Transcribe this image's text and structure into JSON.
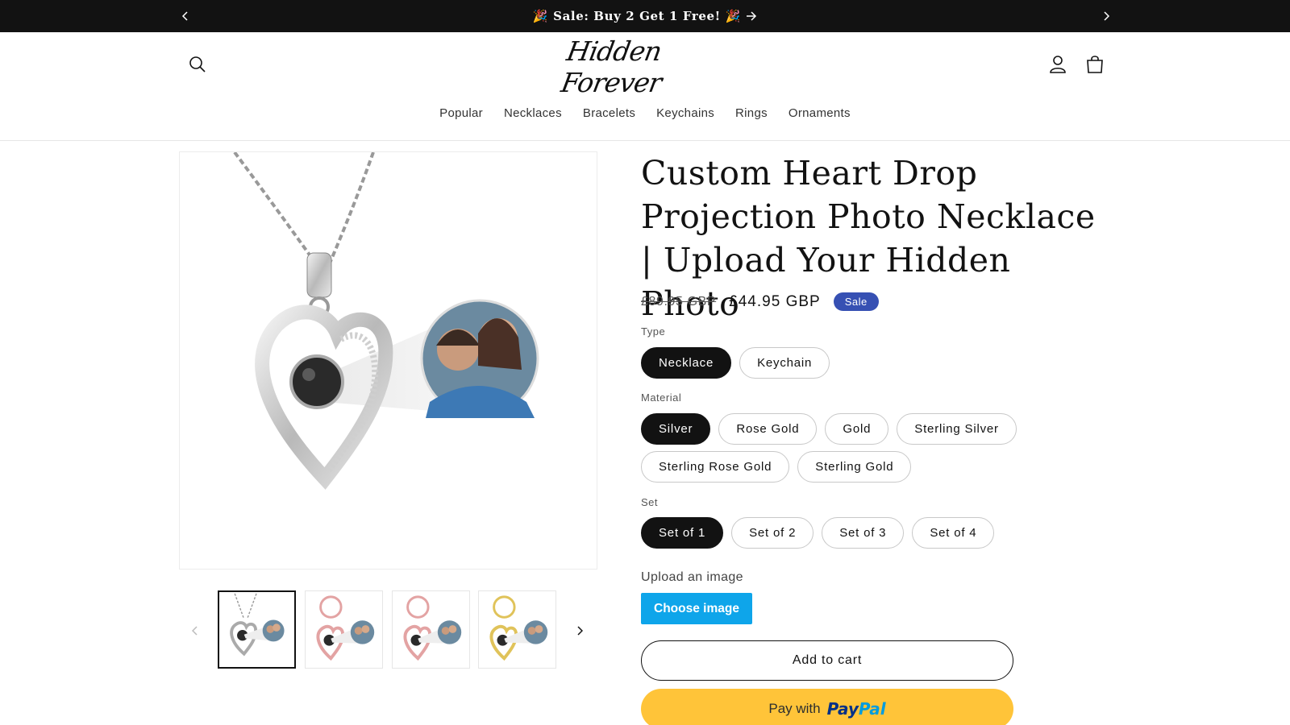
{
  "announcement": {
    "text": "Sale: Buy 2 Get 1 Free!",
    "emoji_left": "🎉",
    "emoji_right": "🎉"
  },
  "header": {
    "logo_text": "Hidden Forever",
    "nav": [
      "Popular",
      "Necklaces",
      "Bracelets",
      "Keychains",
      "Rings",
      "Ornaments"
    ]
  },
  "product": {
    "title": "Custom Heart Drop Projection Photo Necklace | Upload Your Hidden Photo",
    "price_old": "£89.95 GBP",
    "price_new": "£44.95 GBP",
    "badge": "Sale",
    "options": {
      "type": {
        "label": "Type",
        "values": [
          "Necklace",
          "Keychain"
        ],
        "selected": "Necklace"
      },
      "material": {
        "label": "Material",
        "values": [
          "Silver",
          "Rose Gold",
          "Gold",
          "Sterling Silver",
          "Sterling Rose Gold",
          "Sterling Gold"
        ],
        "selected": "Silver"
      },
      "set": {
        "label": "Set",
        "values": [
          "Set of 1",
          "Set of 2",
          "Set of 3",
          "Set of 4"
        ],
        "selected": "Set of 1"
      }
    },
    "upload_label": "Upload an image",
    "choose_label": "Choose image",
    "add_to_cart": "Add to cart",
    "paypal_prefix": "Pay with",
    "paypal_brand_1": "Pay",
    "paypal_brand_2": "Pal"
  },
  "gallery": {
    "thumbnails": [
      {
        "metal": "silver",
        "active": true
      },
      {
        "metal": "rose-gold",
        "active": false
      },
      {
        "metal": "rose-gold",
        "active": false
      },
      {
        "metal": "gold",
        "active": false
      }
    ]
  },
  "colors": {
    "announcement_bg": "#121212",
    "sale_badge": "#3650b3",
    "choose_button": "#0ea5ea",
    "paypal_button": "#ffc439"
  }
}
